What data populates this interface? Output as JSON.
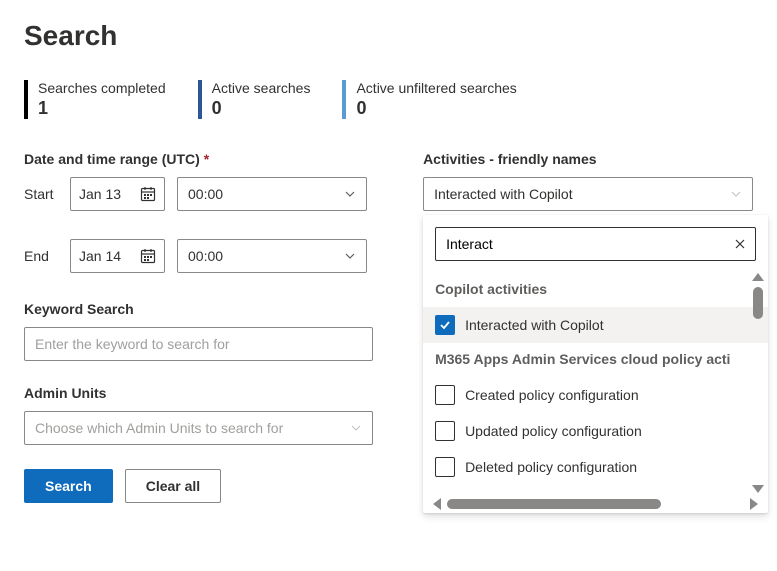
{
  "title": "Search",
  "stats": [
    {
      "label": "Searches completed",
      "value": "1",
      "color": "#000000"
    },
    {
      "label": "Active searches",
      "value": "0",
      "color": "#2b5797"
    },
    {
      "label": "Active unfiltered searches",
      "value": "0",
      "color": "#5b9bd5"
    }
  ],
  "dateRange": {
    "label": "Date and time range (UTC)",
    "required": "*",
    "startLabel": "Start",
    "endLabel": "End",
    "startDate": "Jan 13",
    "startTime": "00:00",
    "endDate": "Jan 14",
    "endTime": "00:00"
  },
  "keyword": {
    "label": "Keyword Search",
    "placeholder": "Enter the keyword to search for"
  },
  "adminUnits": {
    "label": "Admin Units",
    "placeholder": "Choose which Admin Units to search for"
  },
  "activities": {
    "label": "Activities - friendly names",
    "selected": "Interacted with Copilot",
    "search": "Interact",
    "groups": [
      {
        "name": "Copilot activities",
        "options": [
          {
            "label": "Interacted with Copilot",
            "checked": true
          }
        ]
      },
      {
        "name": "M365 Apps Admin Services cloud policy acti",
        "options": [
          {
            "label": "Created policy configuration",
            "checked": false
          },
          {
            "label": "Updated policy configuration",
            "checked": false
          },
          {
            "label": "Deleted policy configuration",
            "checked": false
          }
        ]
      }
    ]
  },
  "buttons": {
    "search": "Search",
    "clear": "Clear all"
  }
}
